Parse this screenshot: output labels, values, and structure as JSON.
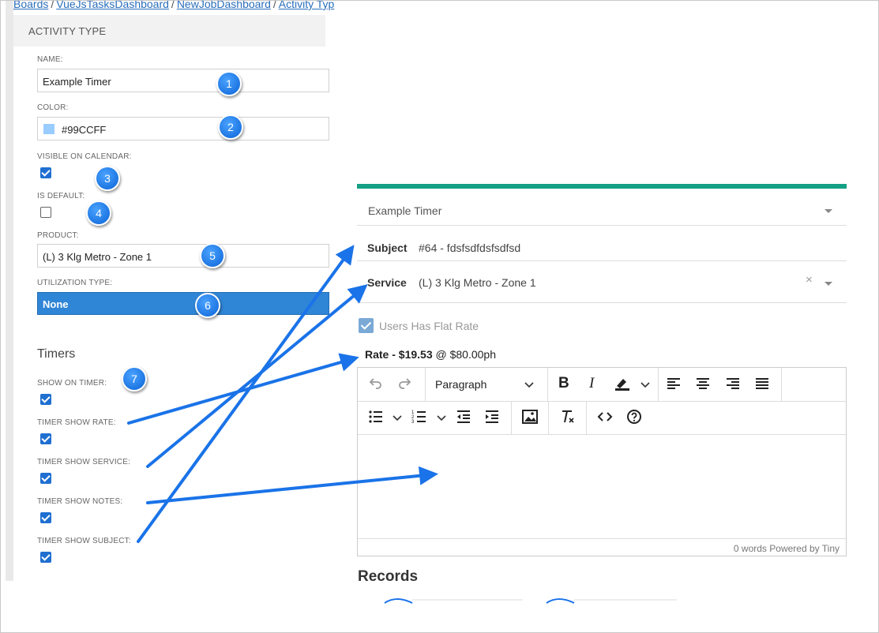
{
  "breadcrumb": {
    "items": [
      "Boards",
      "VueJsTasksDashboard",
      "NewJobDashboard",
      "Activity Typ"
    ],
    "separator": "/"
  },
  "activity_panel": {
    "title": "ACTIVITY TYPE",
    "name_label": "NAME:",
    "name_value": "Example Timer",
    "color_label": "COLOR:",
    "color_value": "#99CCFF",
    "visible_label": "VISIBLE ON CALENDAR:",
    "visible_checked": true,
    "default_label": "IS DEFAULT:",
    "default_checked": false,
    "product_label": "PRODUCT:",
    "product_value": "(L) 3 Klg Metro - Zone 1",
    "utilization_label": "UTILIZATION TYPE:",
    "utilization_value": "None"
  },
  "timers": {
    "title": "Timers",
    "items": [
      {
        "label": "SHOW ON TIMER:",
        "checked": true
      },
      {
        "label": "TIMER SHOW RATE:",
        "checked": true
      },
      {
        "label": "TIMER SHOW SERVICE:",
        "checked": true
      },
      {
        "label": "TIMER SHOW NOTES:",
        "checked": true
      },
      {
        "label": "TIMER SHOW SUBJECT:",
        "checked": true
      }
    ]
  },
  "badges": [
    "1",
    "2",
    "3",
    "4",
    "5",
    "6",
    "7"
  ],
  "timer_form": {
    "activity_select": "Example Timer",
    "subject_label": "Subject",
    "subject_value": "#64 - fdsfsdfdsfsdfsd",
    "service_label": "Service",
    "service_value": "(L) 3 Klg Metro - Zone 1",
    "clear_glyph": "×",
    "flat_rate_label": "Users Has Flat Rate",
    "flat_rate_checked": true,
    "rate_label": "Rate - $19.53",
    "rate_suffix": "@ $80.00ph",
    "editor": {
      "block_format": "Paragraph",
      "word_count": "0 words",
      "powered_by": "Powered by Tiny",
      "toolbar_icons": [
        "undo-icon",
        "redo-icon",
        "bold-icon",
        "italic-icon",
        "highlight-icon",
        "align-left-icon",
        "align-center-icon",
        "align-right-icon",
        "justify-icon",
        "bullet-list-icon",
        "numbered-list-icon",
        "outdent-icon",
        "indent-icon",
        "image-icon",
        "clear-format-icon",
        "code-icon",
        "help-icon"
      ]
    },
    "records_title": "Records"
  },
  "colors": {
    "accent_green": "#13A085",
    "selected_blue": "#2F85D6",
    "swatch": "#99CCFF",
    "arrow_blue": "#1A73E8"
  }
}
